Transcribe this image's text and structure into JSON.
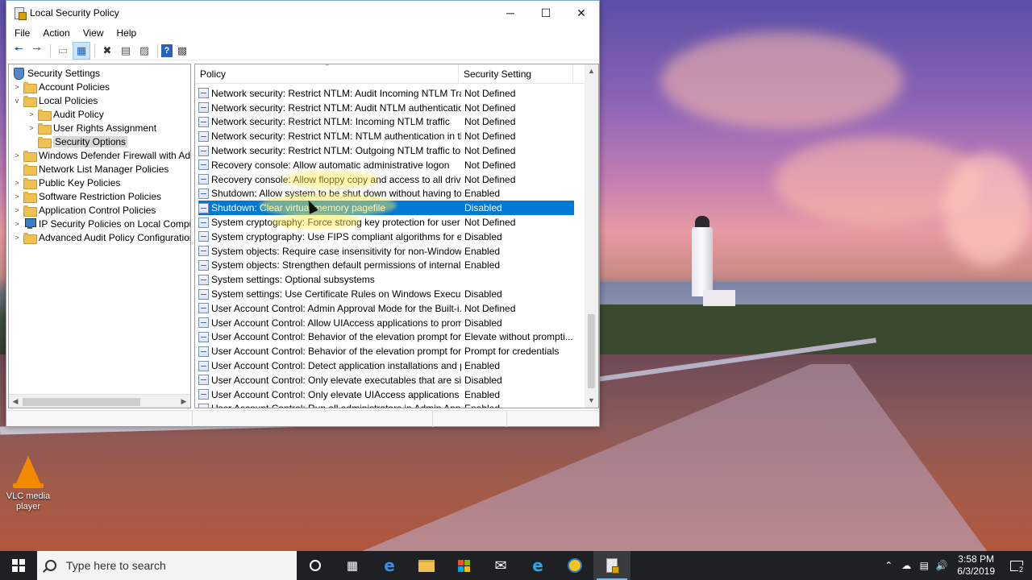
{
  "window": {
    "title": "Local Security Policy",
    "controls": {
      "minimize": "─",
      "maximize": "☐",
      "close": "✕"
    }
  },
  "menu": [
    "File",
    "Action",
    "View",
    "Help"
  ],
  "toolbar": {
    "icons": [
      "back-arrow-icon",
      "forward-arrow-icon",
      "up-folder-icon",
      "show-hide-tree-icon",
      "delete-icon",
      "properties-icon",
      "export-list-icon",
      "help-icon",
      "console-icon"
    ]
  },
  "tree": {
    "items": [
      {
        "label": "Security Settings",
        "icon": "shield-icon",
        "expander": ""
      },
      {
        "label": "Account Policies",
        "icon": "folder-icon",
        "expander": ">"
      },
      {
        "label": "Local Policies",
        "icon": "folder-icon",
        "expander": "v"
      },
      {
        "label": "Audit Policy",
        "icon": "folder-icon",
        "expander": ">"
      },
      {
        "label": "User Rights Assignment",
        "icon": "folder-icon",
        "expander": ">"
      },
      {
        "label": "Security Options",
        "icon": "folder-icon",
        "expander": "",
        "selected": true
      },
      {
        "label": "Windows Defender Firewall with Adva",
        "icon": "folder-icon",
        "expander": ">"
      },
      {
        "label": "Network List Manager Policies",
        "icon": "folder-icon",
        "expander": ""
      },
      {
        "label": "Public Key Policies",
        "icon": "folder-icon",
        "expander": ">"
      },
      {
        "label": "Software Restriction Policies",
        "icon": "folder-icon",
        "expander": ">"
      },
      {
        "label": "Application Control Policies",
        "icon": "folder-icon",
        "expander": ">"
      },
      {
        "label": "IP Security Policies on Local Compute",
        "icon": "ip-security-icon",
        "expander": ">"
      },
      {
        "label": "Advanced Audit Policy Configuration",
        "icon": "folder-icon",
        "expander": ">"
      }
    ]
  },
  "list": {
    "columns": {
      "policy": "Policy",
      "setting": "Security Setting"
    },
    "rows": [
      {
        "policy": "Network security: Restrict NTLM: Audit Incoming NTLM Traf...",
        "setting": "Not Defined"
      },
      {
        "policy": "Network security: Restrict NTLM: Audit NTLM authenticatio...",
        "setting": "Not Defined"
      },
      {
        "policy": "Network security: Restrict NTLM: Incoming NTLM traffic",
        "setting": "Not Defined"
      },
      {
        "policy": "Network security: Restrict NTLM: NTLM authentication in thi...",
        "setting": "Not Defined"
      },
      {
        "policy": "Network security: Restrict NTLM: Outgoing NTLM traffic to r...",
        "setting": "Not Defined"
      },
      {
        "policy": "Recovery console: Allow automatic administrative logon",
        "setting": "Not Defined"
      },
      {
        "policy": "Recovery console: Allow floppy copy and access to all drives...",
        "setting": "Not Defined"
      },
      {
        "policy": "Shutdown: Allow system to be shut down without having to...",
        "setting": "Enabled"
      },
      {
        "policy": "Shutdown: Clear virtual memory pagefile",
        "setting": "Disabled",
        "selected": true
      },
      {
        "policy": "System cryptography: Force strong key protection for user k...",
        "setting": "Not Defined"
      },
      {
        "policy": "System cryptography: Use FIPS compliant algorithms for en...",
        "setting": "Disabled"
      },
      {
        "policy": "System objects: Require case insensitivity for non-Windows ...",
        "setting": "Enabled"
      },
      {
        "policy": "System objects: Strengthen default permissions of internal s...",
        "setting": "Enabled"
      },
      {
        "policy": "System settings: Optional subsystems",
        "setting": ""
      },
      {
        "policy": "System settings: Use Certificate Rules on Windows Executab...",
        "setting": "Disabled"
      },
      {
        "policy": "User Account Control: Admin Approval Mode for the Built-i...",
        "setting": "Not Defined"
      },
      {
        "policy": "User Account Control: Allow UIAccess applications to prom...",
        "setting": "Disabled"
      },
      {
        "policy": "User Account Control: Behavior of the elevation prompt for ...",
        "setting": "Elevate without prompti..."
      },
      {
        "policy": "User Account Control: Behavior of the elevation prompt for ...",
        "setting": "Prompt for credentials"
      },
      {
        "policy": "User Account Control: Detect application installations and p...",
        "setting": "Enabled"
      },
      {
        "policy": "User Account Control: Only elevate executables that are sig...",
        "setting": "Disabled"
      },
      {
        "policy": "User Account Control: Only elevate UIAccess applications th...",
        "setting": "Enabled"
      },
      {
        "policy": "User Account Control: Run all administrators in Admin Appr...",
        "setting": "Enabled"
      }
    ]
  },
  "desktop": {
    "icons": [
      {
        "label": "VLC media player",
        "icon": "vlc-icon"
      }
    ]
  },
  "taskbar": {
    "search_placeholder": "Type here to search",
    "apps": [
      "cortana-icon",
      "task-view-icon",
      "edge-icon",
      "file-explorer-icon",
      "store-icon",
      "mail-icon",
      "internet-explorer-icon",
      "ie-alt-icon",
      "local-security-policy-icon"
    ],
    "clock_time": "3:58 PM",
    "clock_date": "6/3/2019",
    "notification_count": "2"
  },
  "colors": {
    "selection": "#0078d7",
    "taskbar": "#1f2023",
    "folder": "#f0c050",
    "highlight": "#ffeb50"
  }
}
